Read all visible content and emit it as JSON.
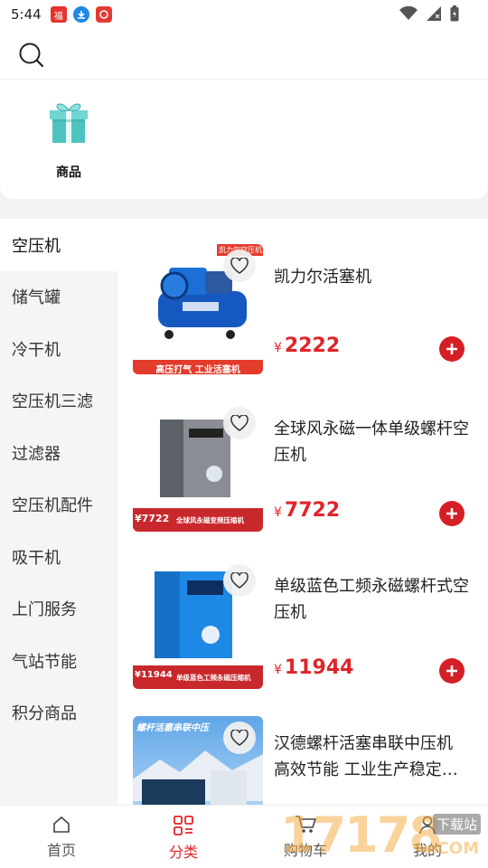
{
  "status_bar": {
    "time": "5:44",
    "icons": [
      "app-red-icon",
      "download-icon",
      "app-icon",
      "wifi-icon",
      "signal-icon",
      "battery-icon"
    ]
  },
  "search": {
    "icon": "search-icon"
  },
  "quick_links": [
    {
      "label": "商品",
      "icon": "gift-box-icon"
    }
  ],
  "sidebar": {
    "items": [
      {
        "label": "空压机",
        "active": true
      },
      {
        "label": "储气罐"
      },
      {
        "label": "冷干机"
      },
      {
        "label": "空压机三滤"
      },
      {
        "label": "过滤器"
      },
      {
        "label": "空压机配件"
      },
      {
        "label": "吸干机"
      },
      {
        "label": "上门服务"
      },
      {
        "label": "气站节能"
      },
      {
        "label": "积分商品"
      }
    ]
  },
  "products": [
    {
      "title": "凯力尔活塞机",
      "currency": "¥",
      "price": "2222",
      "banner_top": "凯力尔空压机",
      "banner_bottom": "高压打气 工业活塞机"
    },
    {
      "title": "全球风永磁一体单级螺杆空压机",
      "currency": "¥",
      "price": "7722",
      "banner_price": "¥7722",
      "banner_bottom": "全球风永磁变频压缩机"
    },
    {
      "title": "单级蓝色工频永磁螺杆式空压机",
      "currency": "¥",
      "price": "11944",
      "banner_price": "¥11944",
      "banner_bottom": "单级蓝色工频永磁压缩机"
    },
    {
      "title": "汉德螺杆活塞串联中压机 高效节能 工业生产稳定供气",
      "banner_top": "螺杆活塞串联中压"
    }
  ],
  "tabbar": {
    "items": [
      {
        "label": "首页",
        "icon": "home-icon"
      },
      {
        "label": "分类",
        "icon": "category-icon",
        "active": true
      },
      {
        "label": "购物车",
        "icon": "cart-icon"
      },
      {
        "label": "我的",
        "icon": "user-icon"
      }
    ]
  },
  "watermark": {
    "text": "17178",
    "sub": "下载站",
    "domain": ".COM"
  },
  "colors": {
    "accent": "#e0242a",
    "add_button": "#d51f26",
    "sidebar_bg": "#f5f5f5"
  }
}
